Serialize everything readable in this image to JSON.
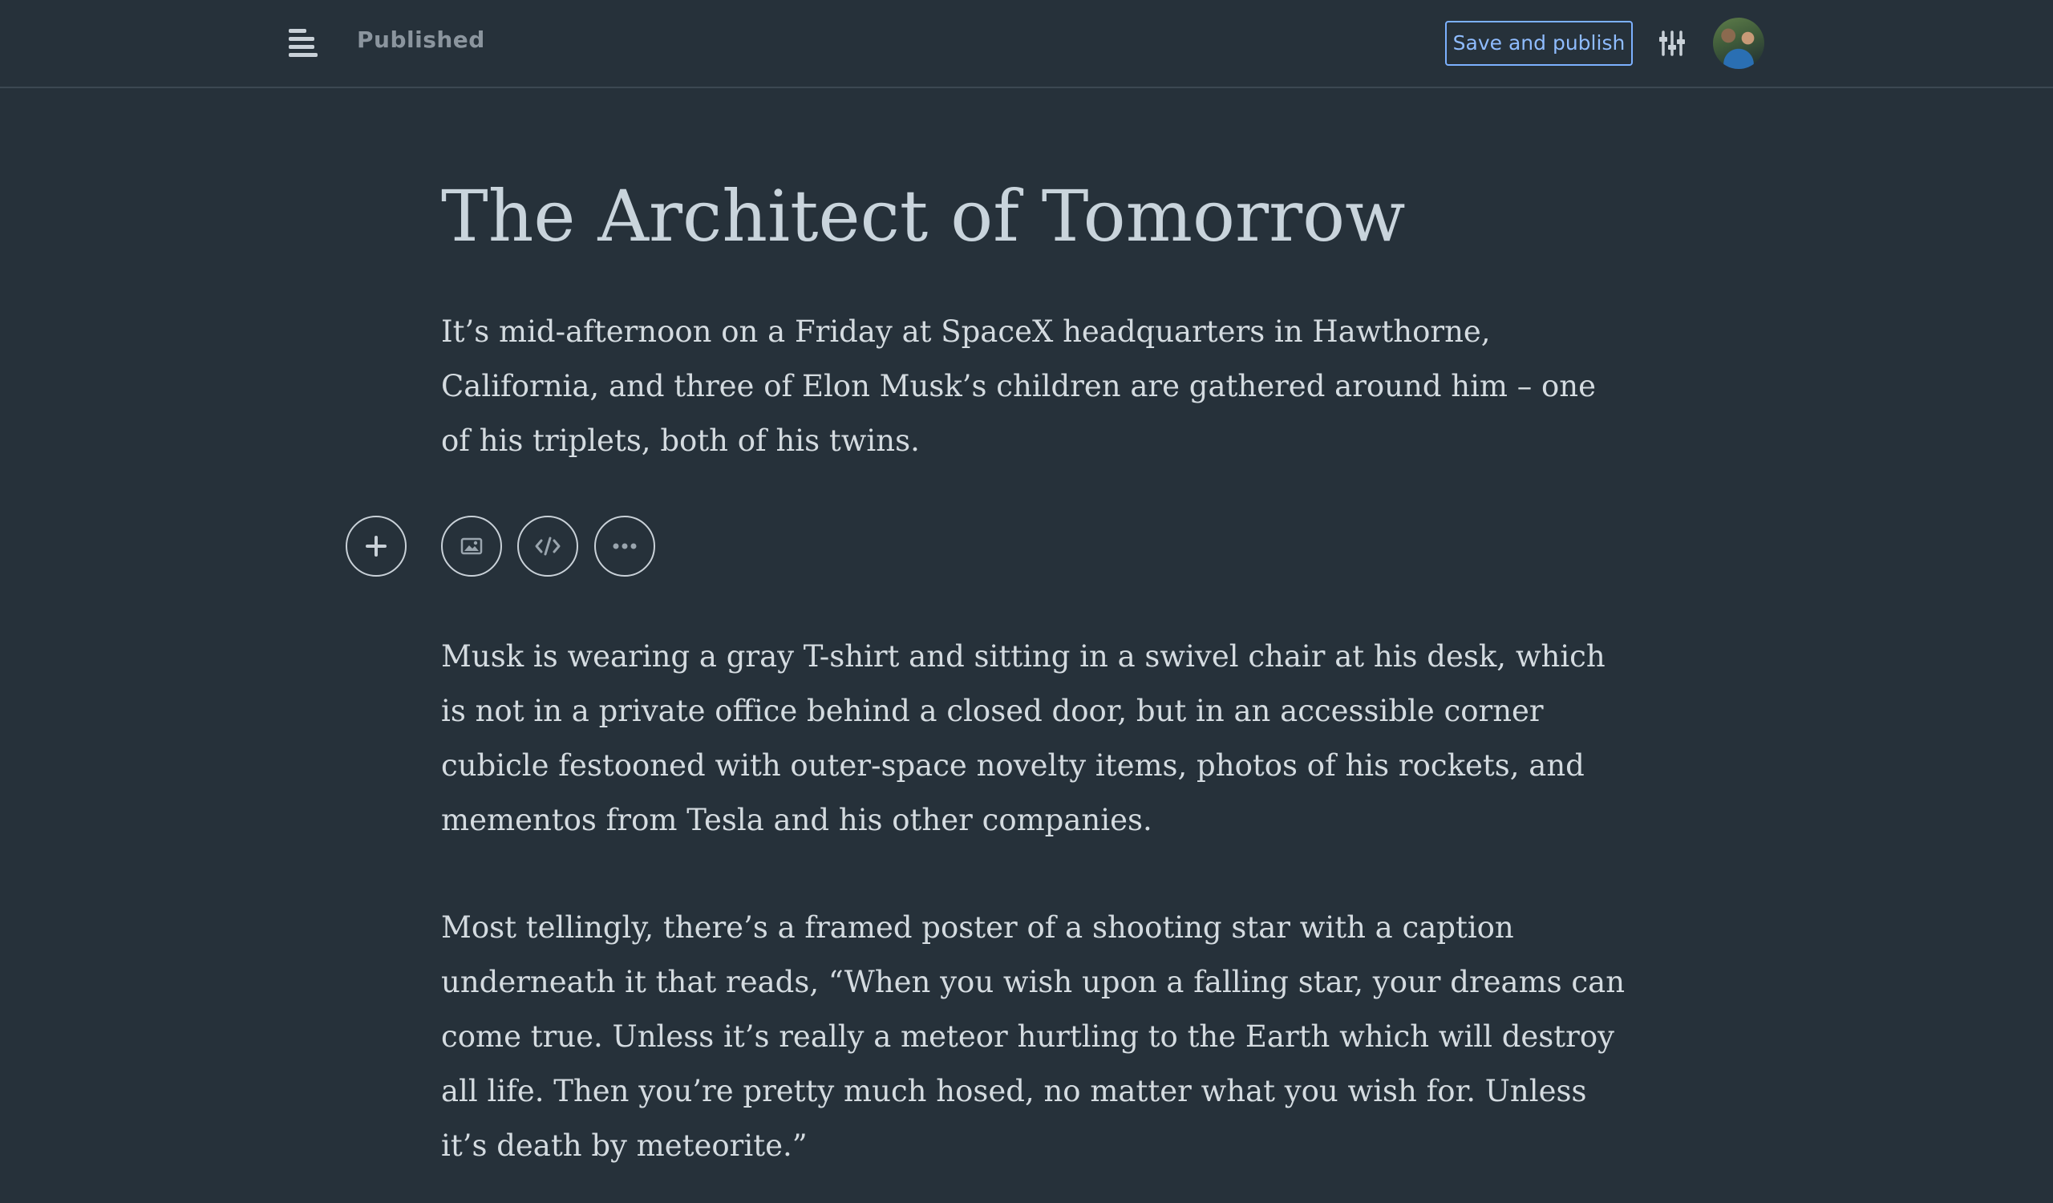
{
  "header": {
    "status": "Published",
    "save_button": "Save and publish",
    "icons": {
      "menu": "menu-icon",
      "settings": "sliders-icon",
      "avatar": "user-avatar"
    },
    "accent_color": "#7cb1ff"
  },
  "post": {
    "title": "The Architect of Tomorrow",
    "paragraphs": [
      "It’s mid-afternoon on a Friday at SpaceX headquarters in Hawthorne, California, and three of Elon Musk’s children are gathered around him – one of his triplets, both of his twins.",
      "Musk is wearing a gray T-shirt and sitting in a swivel chair at his desk, which is not in a private office behind a closed door, but in an accessible corner cubicle festooned with outer-space novelty items, photos of his rockets, and mementos from Tesla and his other companies.",
      "Most tellingly, there’s a framed poster of a shooting star with a caption underneath it that reads, “When you wish upon a falling star, your dreams can come true. Unless it’s really a meteor hurtling to the Earth which will destroy all life. Then you’re pretty much hosed, no matter what you wish for. Unless it’s death by meteorite.”"
    ]
  },
  "inline_toolbar": {
    "add": "plus-icon",
    "image": "image-icon",
    "embed": "code-icon",
    "more": "more-icon"
  }
}
